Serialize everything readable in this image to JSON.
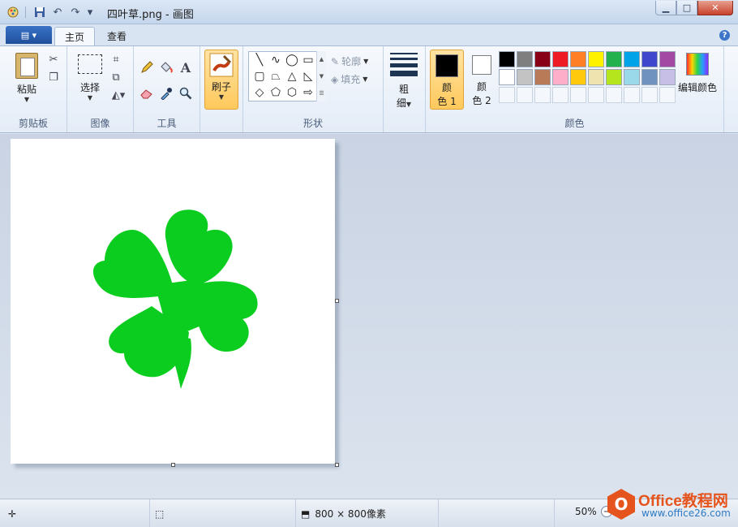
{
  "window": {
    "title": "四叶草.png - 画图",
    "qat_caret": "▾",
    "buttons": {
      "minimize": "▁",
      "maximize": "□",
      "close": "✕"
    }
  },
  "tabs": {
    "file_glyph": "▤ ▾",
    "home": "主页",
    "view": "查看",
    "help": "?"
  },
  "ribbon": {
    "clipboard": {
      "paste": "粘贴",
      "label": "剪贴板"
    },
    "image": {
      "select": "选择",
      "label": "图像"
    },
    "tools": {
      "label": "工具",
      "text_tool": "A"
    },
    "brushes": {
      "label": "刷子"
    },
    "shapes": {
      "outline": "轮廓",
      "fill": "填充",
      "label": "形状"
    },
    "size": {
      "label_line1": "粗",
      "label_line2": "细"
    },
    "colors": {
      "color1_line1": "颜",
      "color1_line2": "色 1",
      "color2_line1": "颜",
      "color2_line2": "色 2",
      "edit": "编辑颜色",
      "label": "颜色",
      "color1": "#000000",
      "color2": "#ffffff",
      "palette_row1": [
        "#000000",
        "#7f7f7f",
        "#880015",
        "#ed1c24",
        "#ff7f27",
        "#fff200",
        "#22b14c",
        "#00a2e8",
        "#3f48cc",
        "#a349a4"
      ],
      "palette_row2": [
        "#ffffff",
        "#c3c3c3",
        "#b97a57",
        "#ffaec9",
        "#ffc90e",
        "#efe4b0",
        "#b5e61d",
        "#99d9ea",
        "#7092be",
        "#c8bfe7"
      ]
    }
  },
  "canvas": {
    "shape_color": "#0bcd20"
  },
  "statusbar": {
    "image_size": "800 × 800像素",
    "zoom": "50%",
    "zoom_minus": "−"
  },
  "watermark": {
    "brand": "Office教程网",
    "url": "www.office26.com",
    "logo_glyph": "O"
  }
}
